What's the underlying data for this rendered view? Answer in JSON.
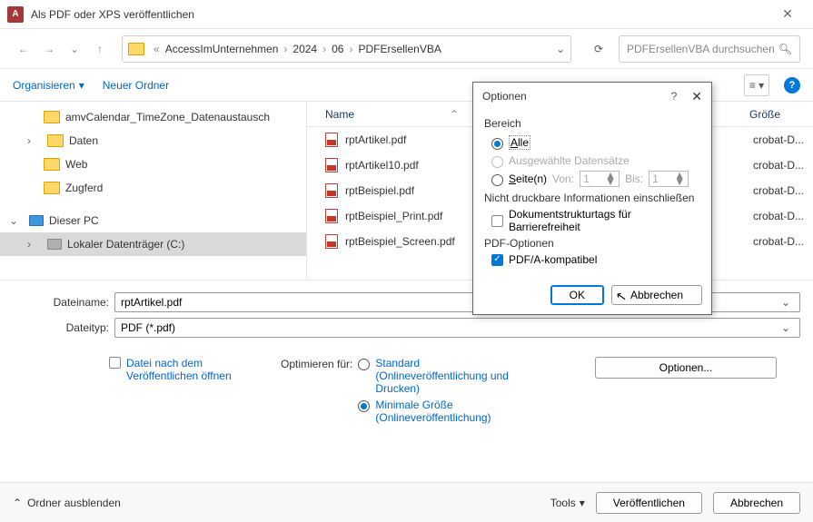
{
  "window": {
    "title": "Als PDF oder XPS veröffentlichen"
  },
  "breadcrumb": {
    "items": [
      "AccessImUnternehmen",
      "2024",
      "06",
      "PDFErsellenVBA"
    ]
  },
  "search": {
    "placeholder": "PDFErsellenVBA durchsuchen"
  },
  "toolbar": {
    "organize": "Organisieren",
    "newfolder": "Neuer Ordner"
  },
  "listhead": {
    "name": "Name",
    "size": "Größe"
  },
  "tree": {
    "items": [
      {
        "label": "amvCalendar_TimeZone_Datenaustausch",
        "exp": ""
      },
      {
        "label": "Daten",
        "exp": "›"
      },
      {
        "label": "Web",
        "exp": ""
      },
      {
        "label": "Zugferd",
        "exp": ""
      }
    ],
    "pc": "Dieser PC",
    "disk": "Lokaler Datenträger (C:)"
  },
  "files": [
    {
      "name": "rptArtikel.pdf",
      "type": "crobat-D..."
    },
    {
      "name": "rptArtikel10.pdf",
      "type": "crobat-D..."
    },
    {
      "name": "rptBeispiel.pdf",
      "type": "crobat-D..."
    },
    {
      "name": "rptBeispiel_Print.pdf",
      "type": "crobat-D..."
    },
    {
      "name": "rptBeispiel_Screen.pdf",
      "type": "crobat-D..."
    }
  ],
  "fields": {
    "fname_label": "Dateiname:",
    "fname_value": "rptArtikel.pdf",
    "ftype_label": "Dateityp:",
    "ftype_value": "PDF (*.pdf)"
  },
  "openafter": {
    "label": "Datei nach dem Veröffentlichen öffnen"
  },
  "optimize": {
    "label": "Optimieren für:",
    "std": "Standard (Onlineveröffentlichung und Drucken)",
    "min": "Minimale Größe (Onlineveröffentlichung)"
  },
  "options_btn": "Optionen...",
  "footer": {
    "hide": "Ordner ausblenden",
    "tools": "Tools",
    "publish": "Veröffentlichen",
    "cancel": "Abbrechen"
  },
  "modal": {
    "title": "Optionen",
    "range": "Bereich",
    "all": "Alle",
    "selected": "Ausgewählte Datensätze",
    "pages": "Seite(n)",
    "from": "Von:",
    "to": "Bis:",
    "from_v": "1",
    "to_v": "1",
    "nonprint": "Nicht druckbare Informationen einschließen",
    "doctags": "Dokumentstrukturtags für Barrierefreiheit",
    "pdfopts": "PDF-Optionen",
    "pdfa": "PDF/A-kompatibel",
    "ok": "OK",
    "cancel": "Abbrechen"
  }
}
